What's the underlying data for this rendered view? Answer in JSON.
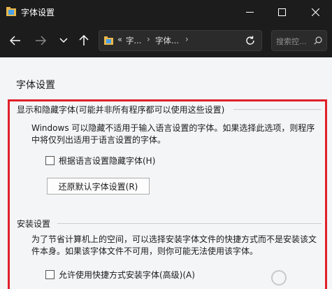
{
  "window": {
    "title": "字体设置",
    "controls": [
      "minimize-icon",
      "maximize-icon",
      "close-icon"
    ]
  },
  "navigation": {
    "buttons": [
      "back-arrow-icon",
      "forward-arrow-icon",
      "chevron-down-icon",
      "up-arrow-icon"
    ],
    "address": {
      "overflow": "«",
      "crumbs": [
        "字...",
        "字体..."
      ],
      "separator": "›"
    },
    "refresh_icon": "refresh-icon",
    "search": {
      "placeholder": "搜索控..."
    }
  },
  "page": {
    "title": "字体设置",
    "show_hide_section": {
      "header": "显示和隐藏字体(可能并非所有程序都可以使用这些设置)",
      "description_line1": "Windows 可以隐藏不适用于输入语言设置的字体。如果选择此选项，则程序",
      "description_line2": "中将仅列出适用于语言设置的字体。",
      "checkbox_label": "根据语言设置隐藏字体(H)",
      "checkbox_checked": false,
      "restore_button_label": "还原默认字体设置(R)"
    },
    "install_section": {
      "header": "安装设置",
      "description_line1": "为了节省计算机上的空间，可以选择安装字体文件的快捷方式而不是安装该文",
      "description_line2": "件本身。如果该字体文件不可用，则你可能无法使用该字体。",
      "checkbox_label": "允许使用快捷方式安装字体(高级)(A)",
      "checkbox_checked": false
    }
  },
  "colors": {
    "titlebar_bg": "#1c1c1c",
    "content_bg": "#f4f5f7",
    "highlight_border": "#e0202a"
  }
}
